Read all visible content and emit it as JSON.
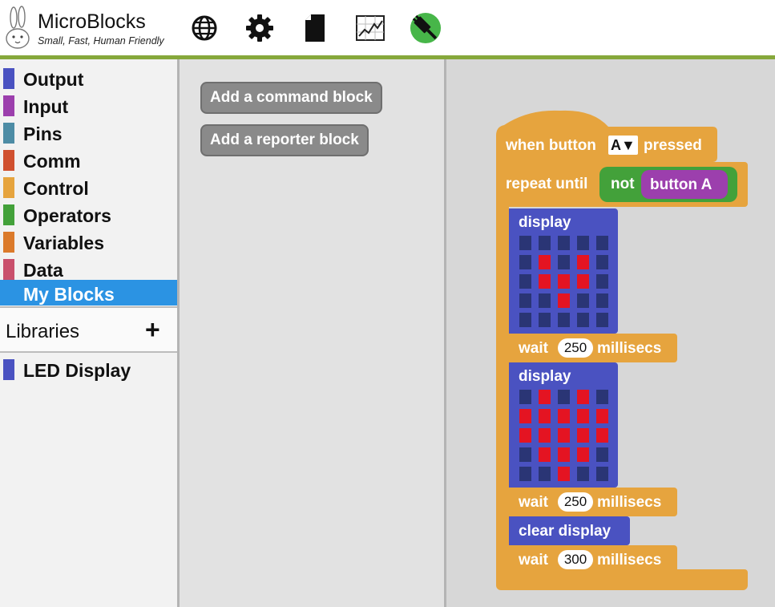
{
  "app": {
    "title": "MicroBlocks",
    "tagline": "Small, Fast, Human Friendly"
  },
  "toolbar": {
    "icons": [
      "globe-icon",
      "gear-icon",
      "file-icon",
      "graph-icon",
      "usb-connect-icon"
    ],
    "connect_color": "#47b649"
  },
  "palette": {
    "categories": [
      {
        "label": "Output",
        "color": "#4a52c1"
      },
      {
        "label": "Input",
        "color": "#9c3fad"
      },
      {
        "label": "Pins",
        "color": "#4d8ca5"
      },
      {
        "label": "Comm",
        "color": "#d0502f"
      },
      {
        "label": "Control",
        "color": "#e6a43e"
      },
      {
        "label": "Operators",
        "color": "#43a13a"
      },
      {
        "label": "Variables",
        "color": "#db7a2b"
      },
      {
        "label": "Data",
        "color": "#c9506c"
      },
      {
        "label": "My Blocks",
        "color": "#2b93e3",
        "selected": true
      }
    ],
    "libraries_label": "Libraries",
    "libraries_add": "+",
    "libraries": [
      {
        "label": "LED Display",
        "color": "#4a52c1"
      }
    ]
  },
  "blocks_palette": {
    "add_command": "Add a command block",
    "add_reporter": "Add a reporter block"
  },
  "script": {
    "hat": {
      "prefix": "when button",
      "button": "A",
      "dropdown_arrow": "▼",
      "suffix": "pressed"
    },
    "repeat_until": {
      "label": "repeat until",
      "not_label": "not",
      "condition": "button A"
    },
    "display1": {
      "label": "display",
      "leds": [
        [
          0,
          0,
          0,
          0,
          0
        ],
        [
          0,
          1,
          0,
          1,
          0
        ],
        [
          0,
          1,
          1,
          1,
          0
        ],
        [
          0,
          0,
          1,
          0,
          0
        ],
        [
          0,
          0,
          0,
          0,
          0
        ]
      ]
    },
    "wait1": {
      "label": "wait",
      "value": "250",
      "unit": "millisecs"
    },
    "display2": {
      "label": "display",
      "leds": [
        [
          0,
          1,
          0,
          1,
          0
        ],
        [
          1,
          1,
          1,
          1,
          1
        ],
        [
          1,
          1,
          1,
          1,
          1
        ],
        [
          0,
          1,
          1,
          1,
          0
        ],
        [
          0,
          0,
          1,
          0,
          0
        ]
      ]
    },
    "wait2": {
      "label": "wait",
      "value": "250",
      "unit": "millisecs"
    },
    "clear": {
      "label": "clear display"
    },
    "wait3": {
      "label": "wait",
      "value": "300",
      "unit": "millisecs"
    }
  },
  "colors": {
    "control": "#e6a43e",
    "operators": "#43a13a",
    "input": "#9c3fad",
    "display": "#4a52c1",
    "led_on": "#e41422",
    "led_off": "#2a3575",
    "accent_bar": "#86a83b"
  }
}
